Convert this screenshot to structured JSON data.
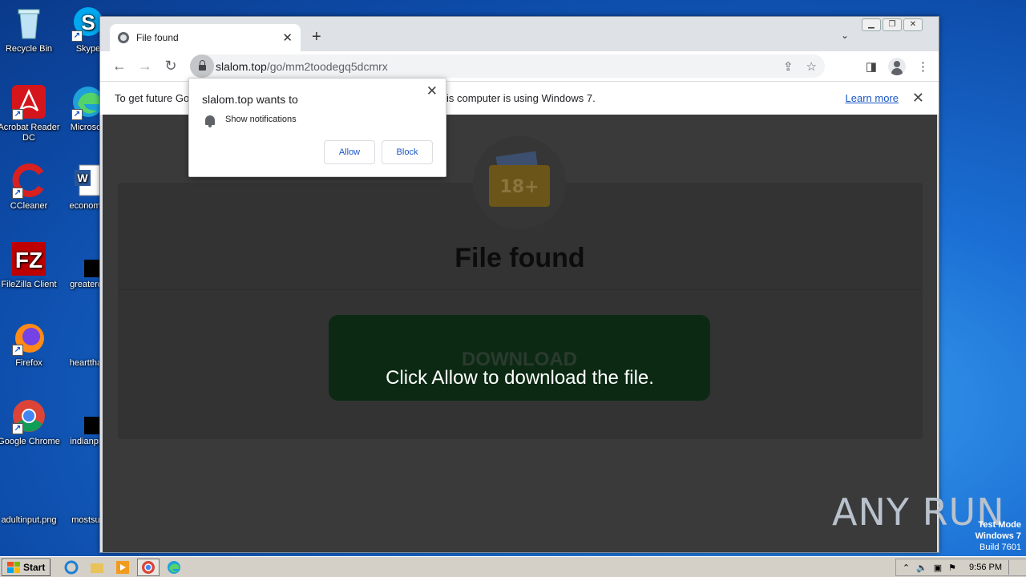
{
  "desktop": {
    "icons": [
      {
        "label": "Recycle Bin"
      },
      {
        "label": "Skype"
      },
      {
        "label": "Acrobat Reader DC"
      },
      {
        "label": "Microsoft"
      },
      {
        "label": "CCleaner"
      },
      {
        "label": "economic"
      },
      {
        "label": "FileZilla Client"
      },
      {
        "label": "greatercc"
      },
      {
        "label": "Firefox"
      },
      {
        "label": "heartthan"
      },
      {
        "label": "Google Chrome"
      },
      {
        "label": "indianpro"
      },
      {
        "label": "adultinput.png"
      },
      {
        "label": "mostsub"
      }
    ]
  },
  "browser": {
    "tab_title": "File found",
    "url_host": "slalom.top",
    "url_path": "/go/mm2toodegq5dcmrx",
    "infobar_text_left": "To get future Go",
    "infobar_text_right": "is computer is using Windows 7.",
    "infobar_link": "Learn more"
  },
  "popup": {
    "title": "slalom.top wants to",
    "permission": "Show notifications",
    "allow": "Allow",
    "block": "Block"
  },
  "page": {
    "badge": "18+",
    "heading": "File found",
    "download_label": "DOWNLOAD",
    "overlay_text": "Click Allow to download the file."
  },
  "watermark": {
    "text": "ANY RUN"
  },
  "system": {
    "test_mode": "Test Mode",
    "os": "Windows 7",
    "build": "Build 7601",
    "time": "9:56 PM",
    "start_label": "Start"
  },
  "colors": {
    "chrome_link": "#1a56c5",
    "download_button": "#0c2a13"
  }
}
